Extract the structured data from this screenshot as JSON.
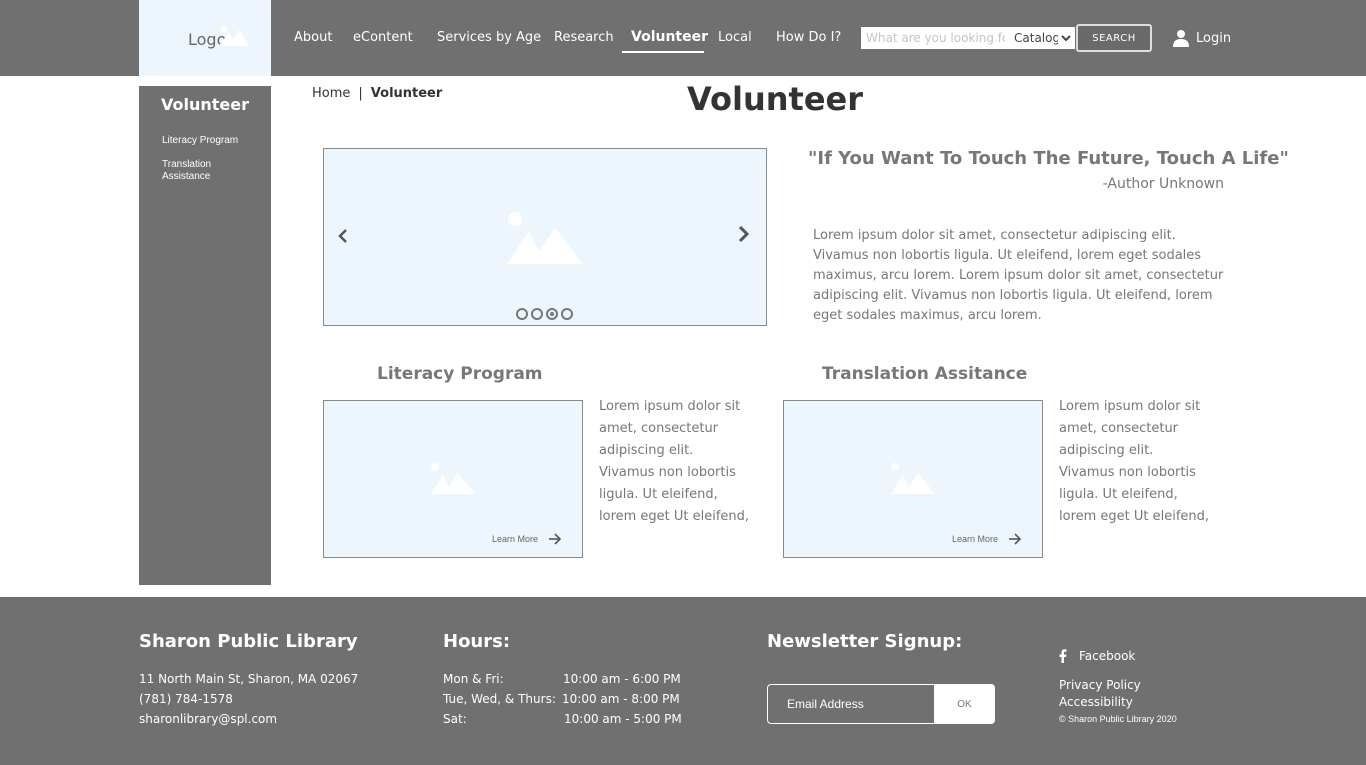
{
  "header": {
    "logo_text": "Logo",
    "nav": [
      {
        "label": "About"
      },
      {
        "label": "eContent"
      },
      {
        "label": "Services by Age"
      },
      {
        "label": "Research"
      },
      {
        "label": "Volunteer",
        "active": true
      },
      {
        "label": "Local"
      },
      {
        "label": "How Do I?"
      }
    ],
    "search": {
      "placeholder": "What are you looking for?",
      "value": "",
      "catalog_option": "Catalog",
      "button_label": "SEARCH"
    },
    "login_label": "Login",
    "login_icon": "user-icon"
  },
  "sidebar": {
    "title": "Volunteer",
    "items": [
      {
        "label": "Literacy Program"
      },
      {
        "label": "Translation Assistance"
      }
    ]
  },
  "breadcrumb": {
    "home": "Home",
    "separator": "|",
    "current": "Volunteer"
  },
  "page_title": "Volunteer",
  "carousel": {
    "prev_icon": "chevron-left-icon",
    "next_icon": "chevron-right-icon",
    "slide_count": 4,
    "active_slide": 3
  },
  "quote": {
    "text": "\"If You Want To Touch The Future, Touch A Life\"",
    "author": "-Author Unknown"
  },
  "intro": "Lorem ipsum dolor sit amet, consectetur adipiscing elit. Vivamus non lobortis ligula. Ut eleifend, lorem eget sodales maximus, arcu lorem. Lorem ipsum dolor sit amet, consectetur adipiscing elit. Vivamus non lobortis ligula.  Ut eleifend, lorem eget sodales maximus, arcu lorem.",
  "cards": [
    {
      "title": "Literacy Program",
      "learn_more": "Learn  More",
      "text": "Lorem ipsum dolor sit amet, consectetur adipiscing elit. Vivamus non lobortis ligula. Ut eleifend, lorem eget Ut eleifend,"
    },
    {
      "title": "Translation Assitance",
      "learn_more": "Learn  More",
      "text": "Lorem ipsum dolor sit amet, consectetur adipiscing elit. Vivamus non lobortis ligula. Ut eleifend, lorem eget Ut eleifend,"
    }
  ],
  "footer": {
    "library": {
      "name": "Sharon Public Library",
      "address": "11 North Main St, Sharon, MA 02067",
      "phone": "(781) 784-1578",
      "email": "sharonlibrary@spl.com"
    },
    "hours": {
      "title": "Hours:",
      "rows": [
        {
          "days": "Mon & Fri:",
          "time": "10:00 am - 6:00 PM"
        },
        {
          "days": "Tue, Wed, & Thurs:",
          "time": "10:00 am - 8:00 PM"
        },
        {
          "days": "Sat:",
          "time": "10:00 am - 5:00 PM"
        }
      ]
    },
    "newsletter": {
      "title": "Newsletter Signup:",
      "email_placeholder": "Email Address",
      "button_label": "OK"
    },
    "links": {
      "facebook": "Facebook",
      "privacy": "Privacy Policy",
      "accessibility": "Accessibility",
      "copyright": "© Sharon Public Library 2020"
    }
  },
  "colors": {
    "header_bg": "#707070",
    "placeholder_bg": "#eef6fd",
    "text_gray": "#777777"
  }
}
